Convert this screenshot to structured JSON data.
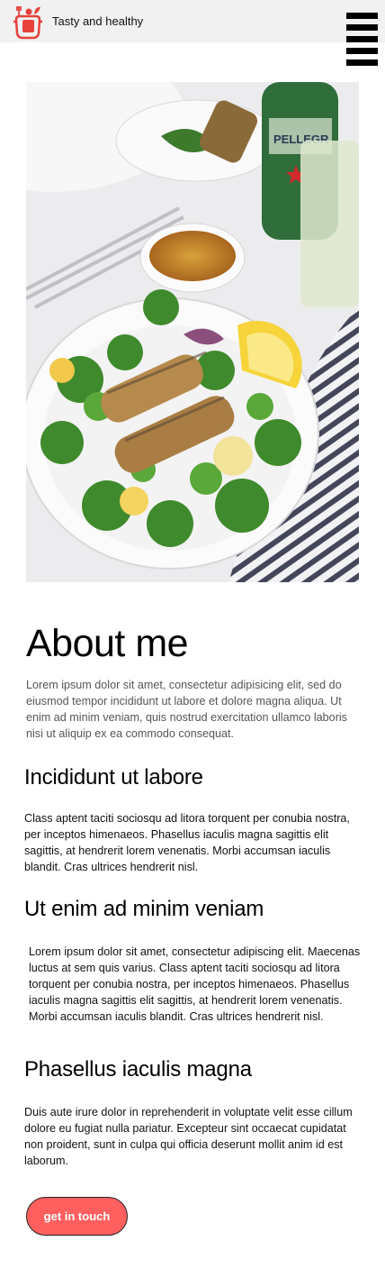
{
  "header": {
    "brand": "Tasty and healthy",
    "logo_icon": "pot-logo-icon",
    "menu_icon": "hamburger-menu-icon"
  },
  "hero": {
    "image": "salad-with-fried-sardines-photo"
  },
  "about": {
    "title": "About me",
    "text": "Lorem ipsum dolor sit amet, consectetur adipisicing elit, sed do eiusmod tempor incididunt ut labore et dolore magna aliqua. Ut enim ad minim veniam, quis nostrud exercitation ullamco laboris nisi ut aliquip ex ea commodo consequat."
  },
  "sections": [
    {
      "title": "Incididunt ut labore",
      "text": "Class aptent taciti sociosqu ad litora torquent per conubia nostra, per inceptos himenaeos. Phasellus iaculis magna sagittis elit sagittis, at hendrerit lorem venenatis. Morbi accumsan iaculis blandit. Cras ultrices hendrerit nisl."
    },
    {
      "title": "Ut enim ad minim veniam",
      "text": "Lorem ipsum dolor sit amet, consectetur adipiscing elit. Maecenas luctus at sem quis varius. Class aptent taciti sociosqu ad litora torquent per conubia nostra, per inceptos himenaeos. Phasellus iaculis magna sagittis elit sagittis, at hendrerit lorem venenatis. Morbi accumsan iaculis blandit. Cras ultrices hendrerit nisl."
    },
    {
      "title": "Phasellus iaculis magna",
      "text": "Duis aute irure dolor in reprehenderit in voluptate velit esse cillum dolore eu fugiat nulla pariatur. Excepteur sint occaecat cupidatat non proident, sunt in culpa qui officia deserunt mollit anim id est laborum."
    }
  ],
  "cta": {
    "label": "get in touch"
  },
  "colors": {
    "accent": "#ff5f5f",
    "header_bg": "#f1f1f1"
  }
}
